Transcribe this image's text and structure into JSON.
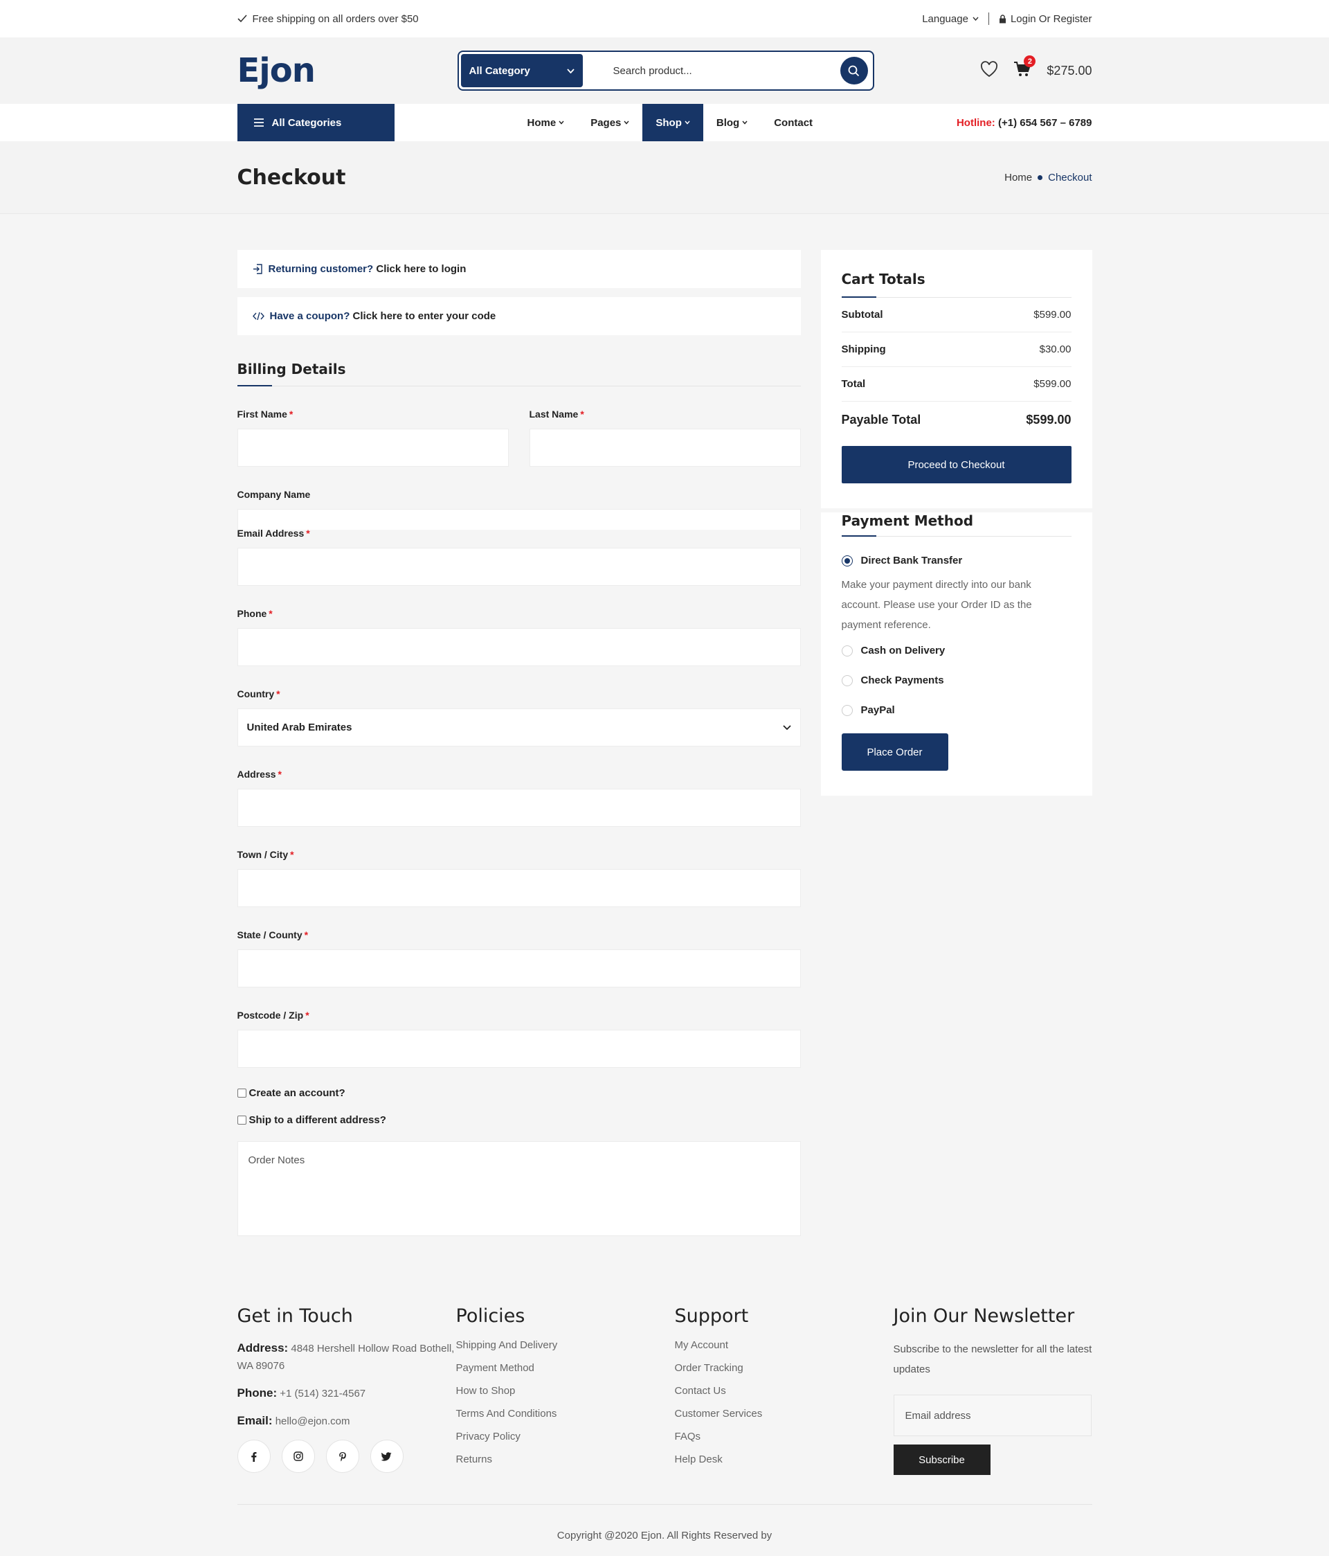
{
  "topbar": {
    "shipping_text": "Free shipping on all orders over $50",
    "language": "Language",
    "login": "Login Or Register"
  },
  "header": {
    "logo": "Ejon",
    "search_category": "All Category",
    "search_placeholder": "Search product...",
    "cart_count": "2",
    "cart_total": "$275.00"
  },
  "nav": {
    "all_categories": "All Categories",
    "items": [
      "Home",
      "Pages",
      "Shop",
      "Blog",
      "Contact"
    ],
    "hotline_label": "Hotline:",
    "hotline_number": "(+1) 654 567 – 6789"
  },
  "page": {
    "title": "Checkout",
    "breadcrumb_home": "Home",
    "breadcrumb_current": "Checkout"
  },
  "notices": {
    "returning_strong": "Returning customer?",
    "returning_rest": " Click here to login",
    "coupon_strong": "Have a coupon?",
    "coupon_rest": " Click here to enter your code"
  },
  "billing": {
    "title": "Billing Details",
    "first_name": "First Name",
    "last_name": "Last Name",
    "company": "Company Name",
    "email": "Email Address",
    "phone": "Phone",
    "country": "Country",
    "country_value": "United Arab Emirates",
    "address": "Address",
    "town": "Town / City",
    "state": "State / County",
    "postcode": "Postcode / Zip",
    "create_account": "Create an account?",
    "ship_different": "Ship to a different address?",
    "notes_placeholder": "Order Notes",
    "required_mark": "*"
  },
  "cart_totals": {
    "title": "Cart Totals",
    "subtotal_label": "Subtotal",
    "subtotal": "$599.00",
    "shipping_label": "Shipping",
    "shipping": "$30.00",
    "total_label": "Total",
    "total": "$599.00",
    "payable_label": "Payable Total",
    "payable": "$599.00",
    "checkout_button": "Proceed to Checkout"
  },
  "payment": {
    "title": "Payment Method",
    "options": [
      "Direct Bank Transfer",
      "Cash on Delivery",
      "Check Payments",
      "PayPal"
    ],
    "description": "Make your payment directly into our bank account. Please use your Order ID as the payment reference.",
    "place_order": "Place Order"
  },
  "footer": {
    "contact_title": "Get in Touch",
    "address_label": "Address:",
    "address": "4848 Hershell Hollow Road Bothell, WA 89076",
    "phone_label": "Phone:",
    "phone": "+1 (514) 321-4567",
    "email_label": "Email:",
    "email": "hello@ejon.com",
    "policies_title": "Policies",
    "policies": [
      "Shipping And Delivery",
      "Payment Method",
      "How to Shop",
      "Terms And Conditions",
      "Privacy Policy",
      "Returns"
    ],
    "support_title": "Support",
    "support": [
      "My Account",
      "Order Tracking",
      "Contact Us",
      "Customer Services",
      "FAQs",
      "Help Desk"
    ],
    "newsletter_title": "Join Our Newsletter",
    "newsletter_desc": "Subscribe to the newsletter for all the latest updates",
    "newsletter_placeholder": "Email address",
    "subscribe": "Subscribe",
    "copyright": "Copyright @2020 Ejon. All Rights Reserved by"
  },
  "colors": {
    "primary": "#173566",
    "accent": "#e31e24"
  }
}
